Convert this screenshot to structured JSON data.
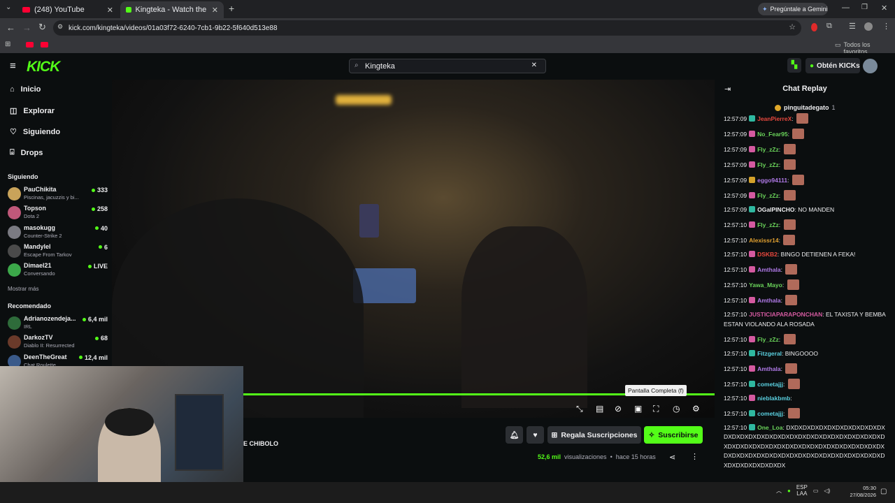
{
  "browser": {
    "tabs": [
      {
        "label": "(248) YouTube"
      },
      {
        "label": "Kingteka - Watch the VOD on K"
      }
    ],
    "url": "kick.com/kingteka/videos/01a03f72-6240-7cb1-9b22-5f640d513e88",
    "gemini_label": "Pregúntale a Gemini",
    "bookmarks_label": "Todos los favoritos"
  },
  "header": {
    "logo": "KICK",
    "search_value": "Kingteka",
    "kicks_label": "Obtén KICKs"
  },
  "nav": [
    {
      "label": "Inicio",
      "icon": "home-icon"
    },
    {
      "label": "Explorar",
      "icon": "compass-icon"
    },
    {
      "label": "Siguiendo",
      "icon": "heart-icon"
    },
    {
      "label": "Drops",
      "icon": "gift-icon"
    }
  ],
  "following": {
    "heading": "Siguiendo",
    "channels": [
      {
        "name": "PauChikita",
        "game": "Piscinas, jacuzzis y bi...",
        "viewers": "333",
        "color": "#c9a35a"
      },
      {
        "name": "Topson",
        "game": "Dota 2",
        "viewers": "258",
        "color": "#c0587a"
      },
      {
        "name": "masokugg",
        "game": "Counter-Strike 2",
        "viewers": "40",
        "color": "#7a7a82"
      },
      {
        "name": "Mandylel",
        "game": "Escape From Tarkov",
        "viewers": "6",
        "color": "#4a4a4a"
      },
      {
        "name": "Dimael21",
        "game": "Conversando",
        "viewers": "LIVE",
        "color": "#3ca84a"
      }
    ],
    "show_more": "Mostrar más"
  },
  "recommended": {
    "heading": "Recomendado",
    "channels": [
      {
        "name": "Adrianozendeja...",
        "game": "IRL",
        "viewers": "6,4 mil",
        "color": "#2e6b3a"
      },
      {
        "name": "DarkozTV",
        "game": "Diablo II: Resurrected",
        "viewers": "68",
        "color": "#6a3a2a"
      },
      {
        "name": "DeenTheGreat",
        "game": "Chat Roulette",
        "viewers": "12,4 mil",
        "color": "#3a5a8a"
      }
    ]
  },
  "player": {
    "tooltip": "Pantalla Completa (f)",
    "progress": 1.0
  },
  "below": {
    "stream_title": "E CHIBOLO",
    "gift_label": "Regala Suscripciones",
    "subscribe_label": "Suscribirse",
    "views_count": "52,6 mil",
    "views_word": "visualizaciones",
    "separator": "•",
    "time_ago": "hace 15 horas"
  },
  "chat": {
    "title": "Chat Replay",
    "pinned_user": "pinguitadegato",
    "pinned_count": "1",
    "messages": [
      {
        "time": "12:57:09",
        "user": "JeanPierreX",
        "color": "#e8483e",
        "badge": "#2fb8a0",
        "text": "",
        "emote": true
      },
      {
        "time": "12:57:09",
        "user": "No_Fear95",
        "color": "#6ad35a",
        "badge": "#d45aa0",
        "text": "",
        "emote": true
      },
      {
        "time": "12:57:09",
        "user": "Fly_zZz",
        "color": "#6ad35a",
        "badge": "#d45aa0",
        "text": "",
        "emote": true
      },
      {
        "time": "12:57:09",
        "user": "Fly_zZz",
        "color": "#6ad35a",
        "badge": "#d45aa0",
        "text": "",
        "emote": true
      },
      {
        "time": "12:57:09",
        "user": "eggo94111",
        "color": "#b07ae8",
        "badge": "#d4a12a",
        "text": "",
        "emote": true
      },
      {
        "time": "12:57:09",
        "user": "Fly_zZz",
        "color": "#6ad35a",
        "badge": "#d45aa0",
        "text": "",
        "emote": true
      },
      {
        "time": "12:57:09",
        "user": "OGalPINCHO",
        "color": "#efeff1",
        "badge": "#2fb8a0",
        "text": "NO MANDEN",
        "emote": false
      },
      {
        "time": "12:57:10",
        "user": "Fly_zZz",
        "color": "#6ad35a",
        "badge": "#d45aa0",
        "text": "",
        "emote": true
      },
      {
        "time": "12:57:10",
        "user": "Alexissr14",
        "color": "#e0a030",
        "badge": "",
        "text": "",
        "emote": true
      },
      {
        "time": "12:57:10",
        "user": "DSKB2",
        "color": "#e8483e",
        "badge": "#d45aa0",
        "text": "BINGO DETIENEN A FEKA!",
        "emote": false
      },
      {
        "time": "12:57:10",
        "user": "Amthala",
        "color": "#b07ae8",
        "badge": "#d45aa0",
        "text": "",
        "emote": true
      },
      {
        "time": "12:57:10",
        "user": "Yawa_Mayo",
        "color": "#6ad35a",
        "badge": "",
        "text": "",
        "emote": true
      },
      {
        "time": "12:57:10",
        "user": "Amthala",
        "color": "#b07ae8",
        "badge": "#d45aa0",
        "text": "",
        "emote": true
      },
      {
        "time": "12:57:10",
        "user": "JUSTICIAPARAPONCHAN",
        "color": "#d45aa0",
        "badge": "",
        "text": "EL TAXISTA Y BEMBA ESTAN VIOLANDO ALA ROSADA",
        "emote": false
      },
      {
        "time": "12:57:10",
        "user": "Fly_zZz",
        "color": "#6ad35a",
        "badge": "#d45aa0",
        "text": "",
        "emote": true
      },
      {
        "time": "12:57:10",
        "user": "Fitzgeral",
        "color": "#5ad0e0",
        "badge": "#2fb8a0",
        "text": "BINGOOOO",
        "emote": false
      },
      {
        "time": "12:57:10",
        "user": "Amthala",
        "color": "#b07ae8",
        "badge": "#d45aa0",
        "text": "",
        "emote": true
      },
      {
        "time": "12:57:10",
        "user": "cometajjj",
        "color": "#5ad0e0",
        "badge": "#2fb8a0",
        "text": "",
        "emote": true
      },
      {
        "time": "12:57:10",
        "user": "nieblakbmb",
        "color": "#5ad0e0",
        "badge": "#d45aa0",
        "text": "",
        "emote": false
      },
      {
        "time": "12:57:10",
        "user": "cometajjj",
        "color": "#5ad0e0",
        "badge": "#2fb8a0",
        "text": "",
        "emote": true
      },
      {
        "time": "12:57:10",
        "user": "One_Loa",
        "color": "#6ad35a",
        "badge": "#2fb8a0",
        "text": "DXDXDXDXDXDXDXDXDXDXDXDXDXDXDXDXDXDXDXDXDXDXDXDXDXDXDXDXDXDXDXDXDXDXDXDXDXDXDXDXDXDXDXDXDXDXDXDXDXDXDXDXDXDXDXDXDXDXDXDXDXDXDXDXDXDXDXDXDXDXDXDXDXDXDXDXDXDX",
        "emote": false
      }
    ]
  },
  "taskbar": {
    "lang_top": "ESP",
    "lang_bottom": "LAA",
    "time": "05:30",
    "date": "27/08/2026"
  },
  "colors": {
    "brand": "#53fc18",
    "bg": "#0b0e0f"
  }
}
